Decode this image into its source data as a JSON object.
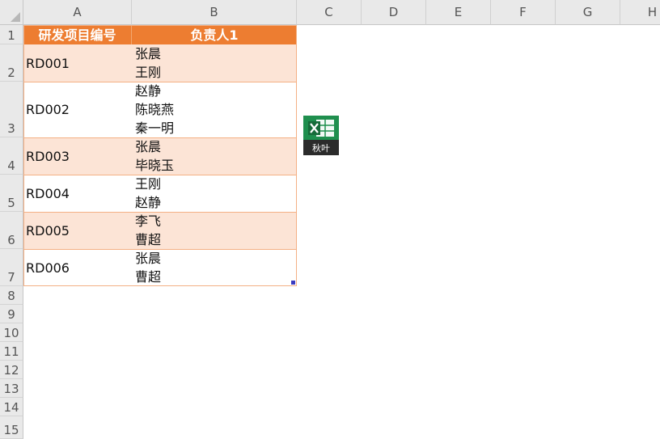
{
  "columns": [
    "A",
    "B",
    "C",
    "D",
    "E",
    "F",
    "G",
    "H"
  ],
  "rows": [
    "1",
    "2",
    "3",
    "4",
    "5",
    "6",
    "7",
    "8",
    "9",
    "10",
    "11",
    "12",
    "13",
    "14",
    "15"
  ],
  "table": {
    "headers": [
      "研发项目编号",
      "负责人1"
    ],
    "records": [
      {
        "id": "RD001",
        "names": [
          "张晨",
          "王刚"
        ]
      },
      {
        "id": "RD002",
        "names": [
          "赵静",
          "陈晓燕",
          "秦一明"
        ]
      },
      {
        "id": "RD003",
        "names": [
          "张晨",
          "毕晓玉"
        ]
      },
      {
        "id": "RD004",
        "names": [
          "王刚",
          "赵静"
        ]
      },
      {
        "id": "RD005",
        "names": [
          "李飞",
          "曹超"
        ]
      },
      {
        "id": "RD006",
        "names": [
          "张晨",
          "曹超"
        ]
      }
    ]
  },
  "badge": {
    "label": "秋叶",
    "icon": "excel-icon"
  },
  "colors": {
    "header": "#ed7d31",
    "band": "#fce4d6",
    "badge": "#1f8f4e"
  }
}
